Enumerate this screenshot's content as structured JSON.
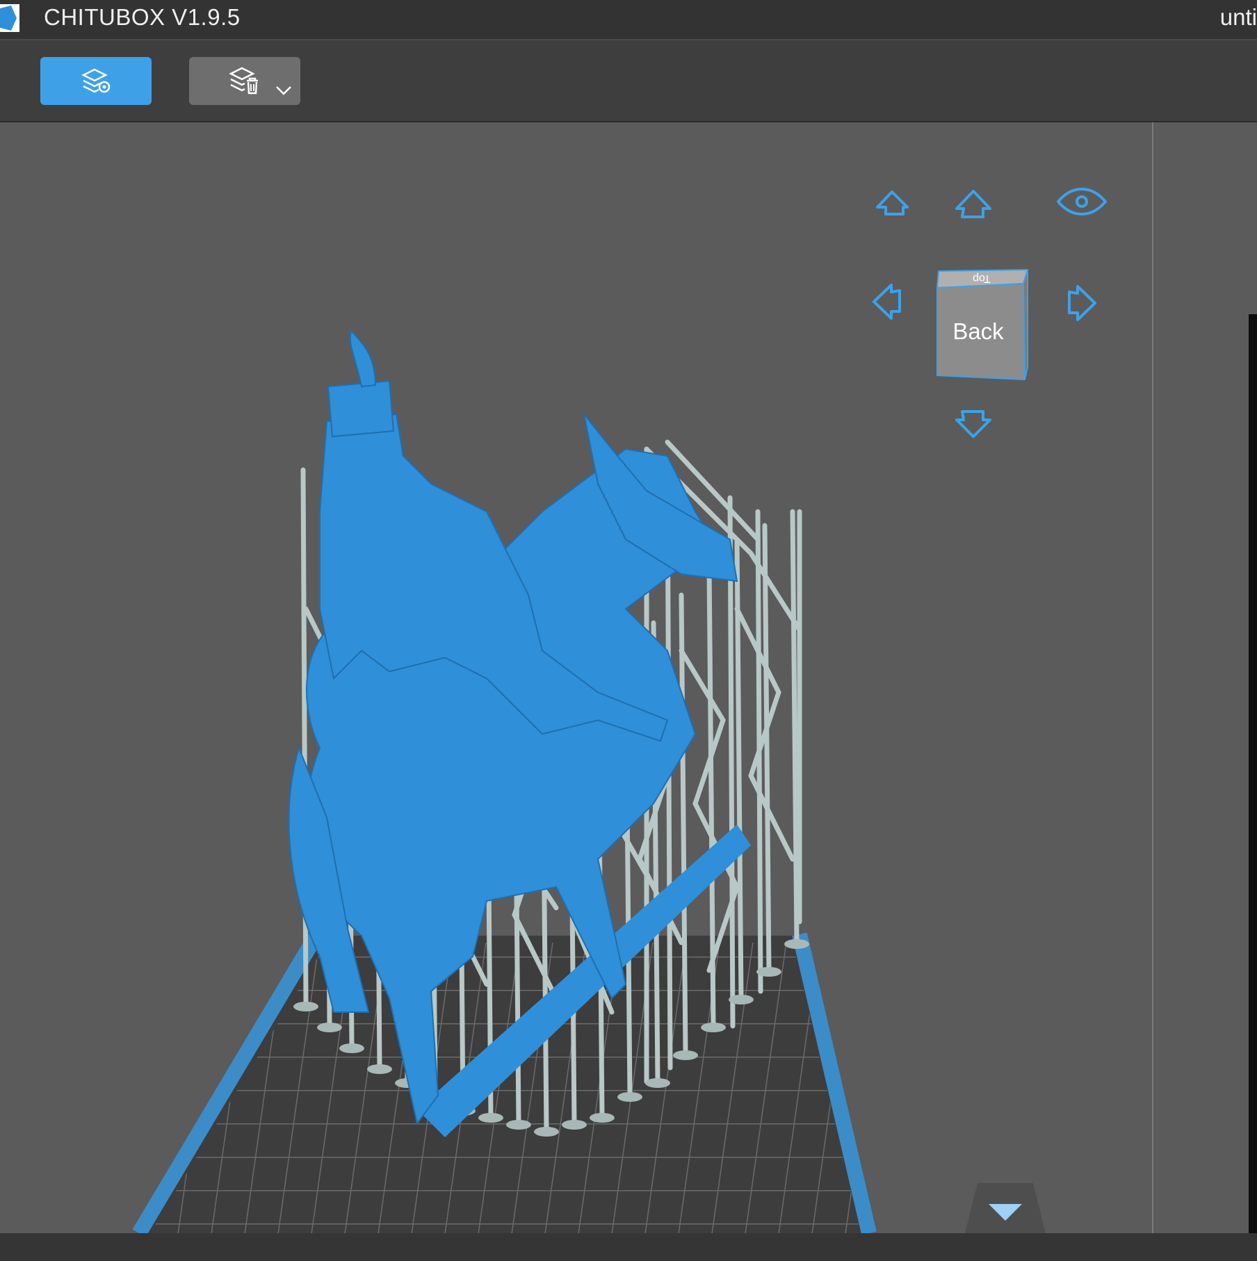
{
  "app": {
    "title": "CHITUBOX V1.9.5",
    "file_title": "unti"
  },
  "toolbar": {
    "slice_icon": "layers-settings-icon",
    "delete_supports_icon": "layers-trash-icon",
    "dropdown_icon": "chevron-down-icon"
  },
  "view_controls": {
    "home_icon": "home-icon",
    "visibility_icon": "eye-icon",
    "rotate_up_icon": "arrow-up-icon",
    "rotate_down_icon": "arrow-down-icon",
    "rotate_left_icon": "arrow-left-icon",
    "rotate_right_icon": "arrow-right-icon",
    "cube_front_label": "Back",
    "cube_top_label": "Top"
  },
  "colors": {
    "accent": "#3ea1e8",
    "model": "#2f8fd8",
    "supports": "#b8c8c6",
    "plate_border": "#3c8cc8"
  }
}
